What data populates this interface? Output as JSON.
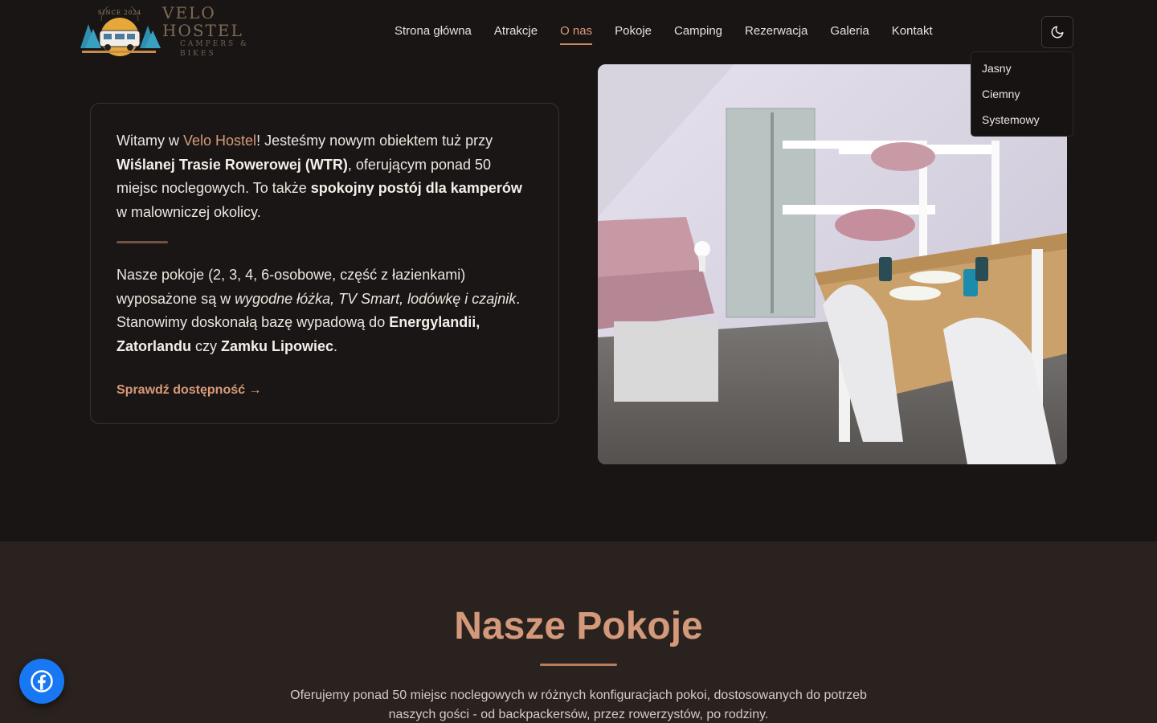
{
  "logo": {
    "title": "VELO HOSTEL",
    "subtitle": "CAMPERS & BIKES",
    "badge_text": "SINCE 2024"
  },
  "nav": {
    "items": [
      {
        "label": "Strona główna",
        "active": false
      },
      {
        "label": "Atrakcje",
        "active": false
      },
      {
        "label": "O nas",
        "active": true
      },
      {
        "label": "Pokoje",
        "active": false
      },
      {
        "label": "Camping",
        "active": false
      },
      {
        "label": "Rezerwacja",
        "active": false
      },
      {
        "label": "Galeria",
        "active": false
      },
      {
        "label": "Kontakt",
        "active": false
      }
    ]
  },
  "theme": {
    "icon": "moon-icon",
    "options": [
      "Jasny",
      "Ciemny",
      "Systemowy"
    ]
  },
  "intro": {
    "p1": {
      "t1": "Witamy w ",
      "brand": "Velo Hostel",
      "t2": "! Jesteśmy nowym obiektem tuż przy ",
      "b1": "Wiślanej Trasie Rowerowej (WTR)",
      "t3": ", oferującym ponad 50 miejsc noclegowych. To także ",
      "b2": "spokojny postój dla kamperów",
      "t4": " w malowniczej okolicy."
    },
    "p2": {
      "t1": "Nasze pokoje (2, 3, 4, 6-osobowe, część z łazienkami) wyposażone są w ",
      "i1": "wygodne łóżka, TV Smart, lodówkę i czajnik",
      "t2": ". Stanowimy doskonałą bazę wypadową do ",
      "b1": "Energylandii, Zatorlandu",
      "t3": " czy ",
      "b2": "Zamku Lipowiec",
      "t4": "."
    },
    "link": "Sprawdź dostępność →"
  },
  "rooms": {
    "title": "Nasze Pokoje",
    "text": "Oferujemy ponad 50 miejsc noclegowych w różnych konfiguracjach pokoi, dostosowanych do potrzeb naszych gości - od backpackersów, przez rowerzystów, po rodziny."
  },
  "colors": {
    "background": "#1a1515",
    "accent": "#d89a78",
    "section_bg": "#2a221e",
    "facebook": "#1877f2"
  },
  "facebook": {
    "icon": "facebook-icon"
  }
}
